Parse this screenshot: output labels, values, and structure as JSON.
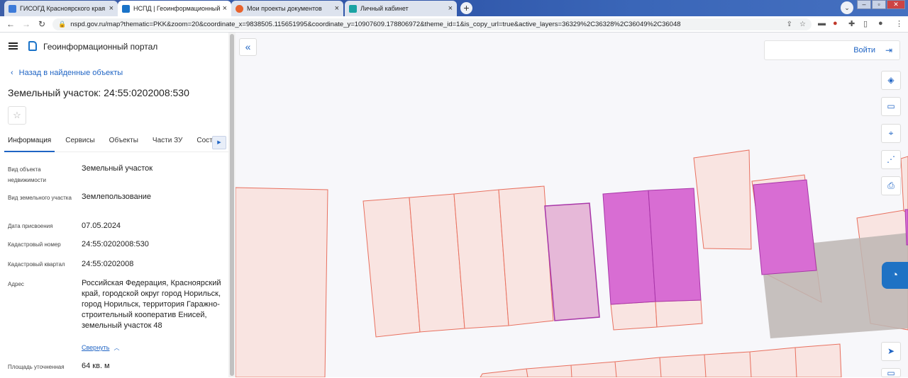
{
  "browser": {
    "tabs": [
      {
        "title": "ГИСОГД Красноярского края",
        "favicon_color": "#3d7bd9"
      },
      {
        "title": "НСПД | Геоинформационный п",
        "favicon_color": "#1a73c8"
      },
      {
        "title": "Мои проекты документов",
        "favicon_color": "#e8622c"
      },
      {
        "title": "Личный кабинет",
        "favicon_color": "#1aa3a3"
      }
    ],
    "close_glyph": "×",
    "new_tab_glyph": "+",
    "url": "nspd.gov.ru/map?thematic=PKK&zoom=20&coordinate_x=9838505.115651995&coordinate_y=10907609.178806972&theme_id=1&is_copy_url=true&active_layers=36329%2C36328%2C36049%2C36048"
  },
  "panel": {
    "portal_title": "Геоинформационный портал",
    "back_link": "Назад в найденные объекты",
    "object_title": "Земельный участок: 24:55:0202008:530",
    "tabs": [
      "Информация",
      "Сервисы",
      "Объекты",
      "Части ЗУ",
      "Соста"
    ],
    "fields": [
      {
        "label": "Вид объекта недвижимости",
        "value": "Земельный участок"
      },
      {
        "label": "Вид земельного участка",
        "value": "Землепользование"
      },
      {
        "label": "Дата присвоения",
        "value": "07.05.2024"
      },
      {
        "label": "Кадастровый номер",
        "value": "24:55:0202008:530"
      },
      {
        "label": "Кадастровый квартал",
        "value": "24:55:0202008"
      },
      {
        "label": "Адрес",
        "value": "Российская Федерация, Красноярский край, городской округ город Норильск, город Норильск, территория Гаражно-строительный кооператив Енисей, земельный участок 48"
      },
      {
        "label": "Площадь уточненная",
        "value": "64 кв. м"
      }
    ],
    "collapse_link": "Свернуть"
  },
  "map": {
    "login_label": "Войти",
    "tools": [
      "layers-icon",
      "ruler-icon",
      "select-area-icon",
      "share-icon",
      "print-icon",
      "locate-icon"
    ],
    "colors": {
      "parcel_fill": "#f9e1dc",
      "parcel_stroke": "#e8705f",
      "selected_fill": "#e6b8d8",
      "highlight_fill": "#d86dd3",
      "highlight_stroke": "#a836a8",
      "gray_zone": "#bdb6b3"
    }
  }
}
